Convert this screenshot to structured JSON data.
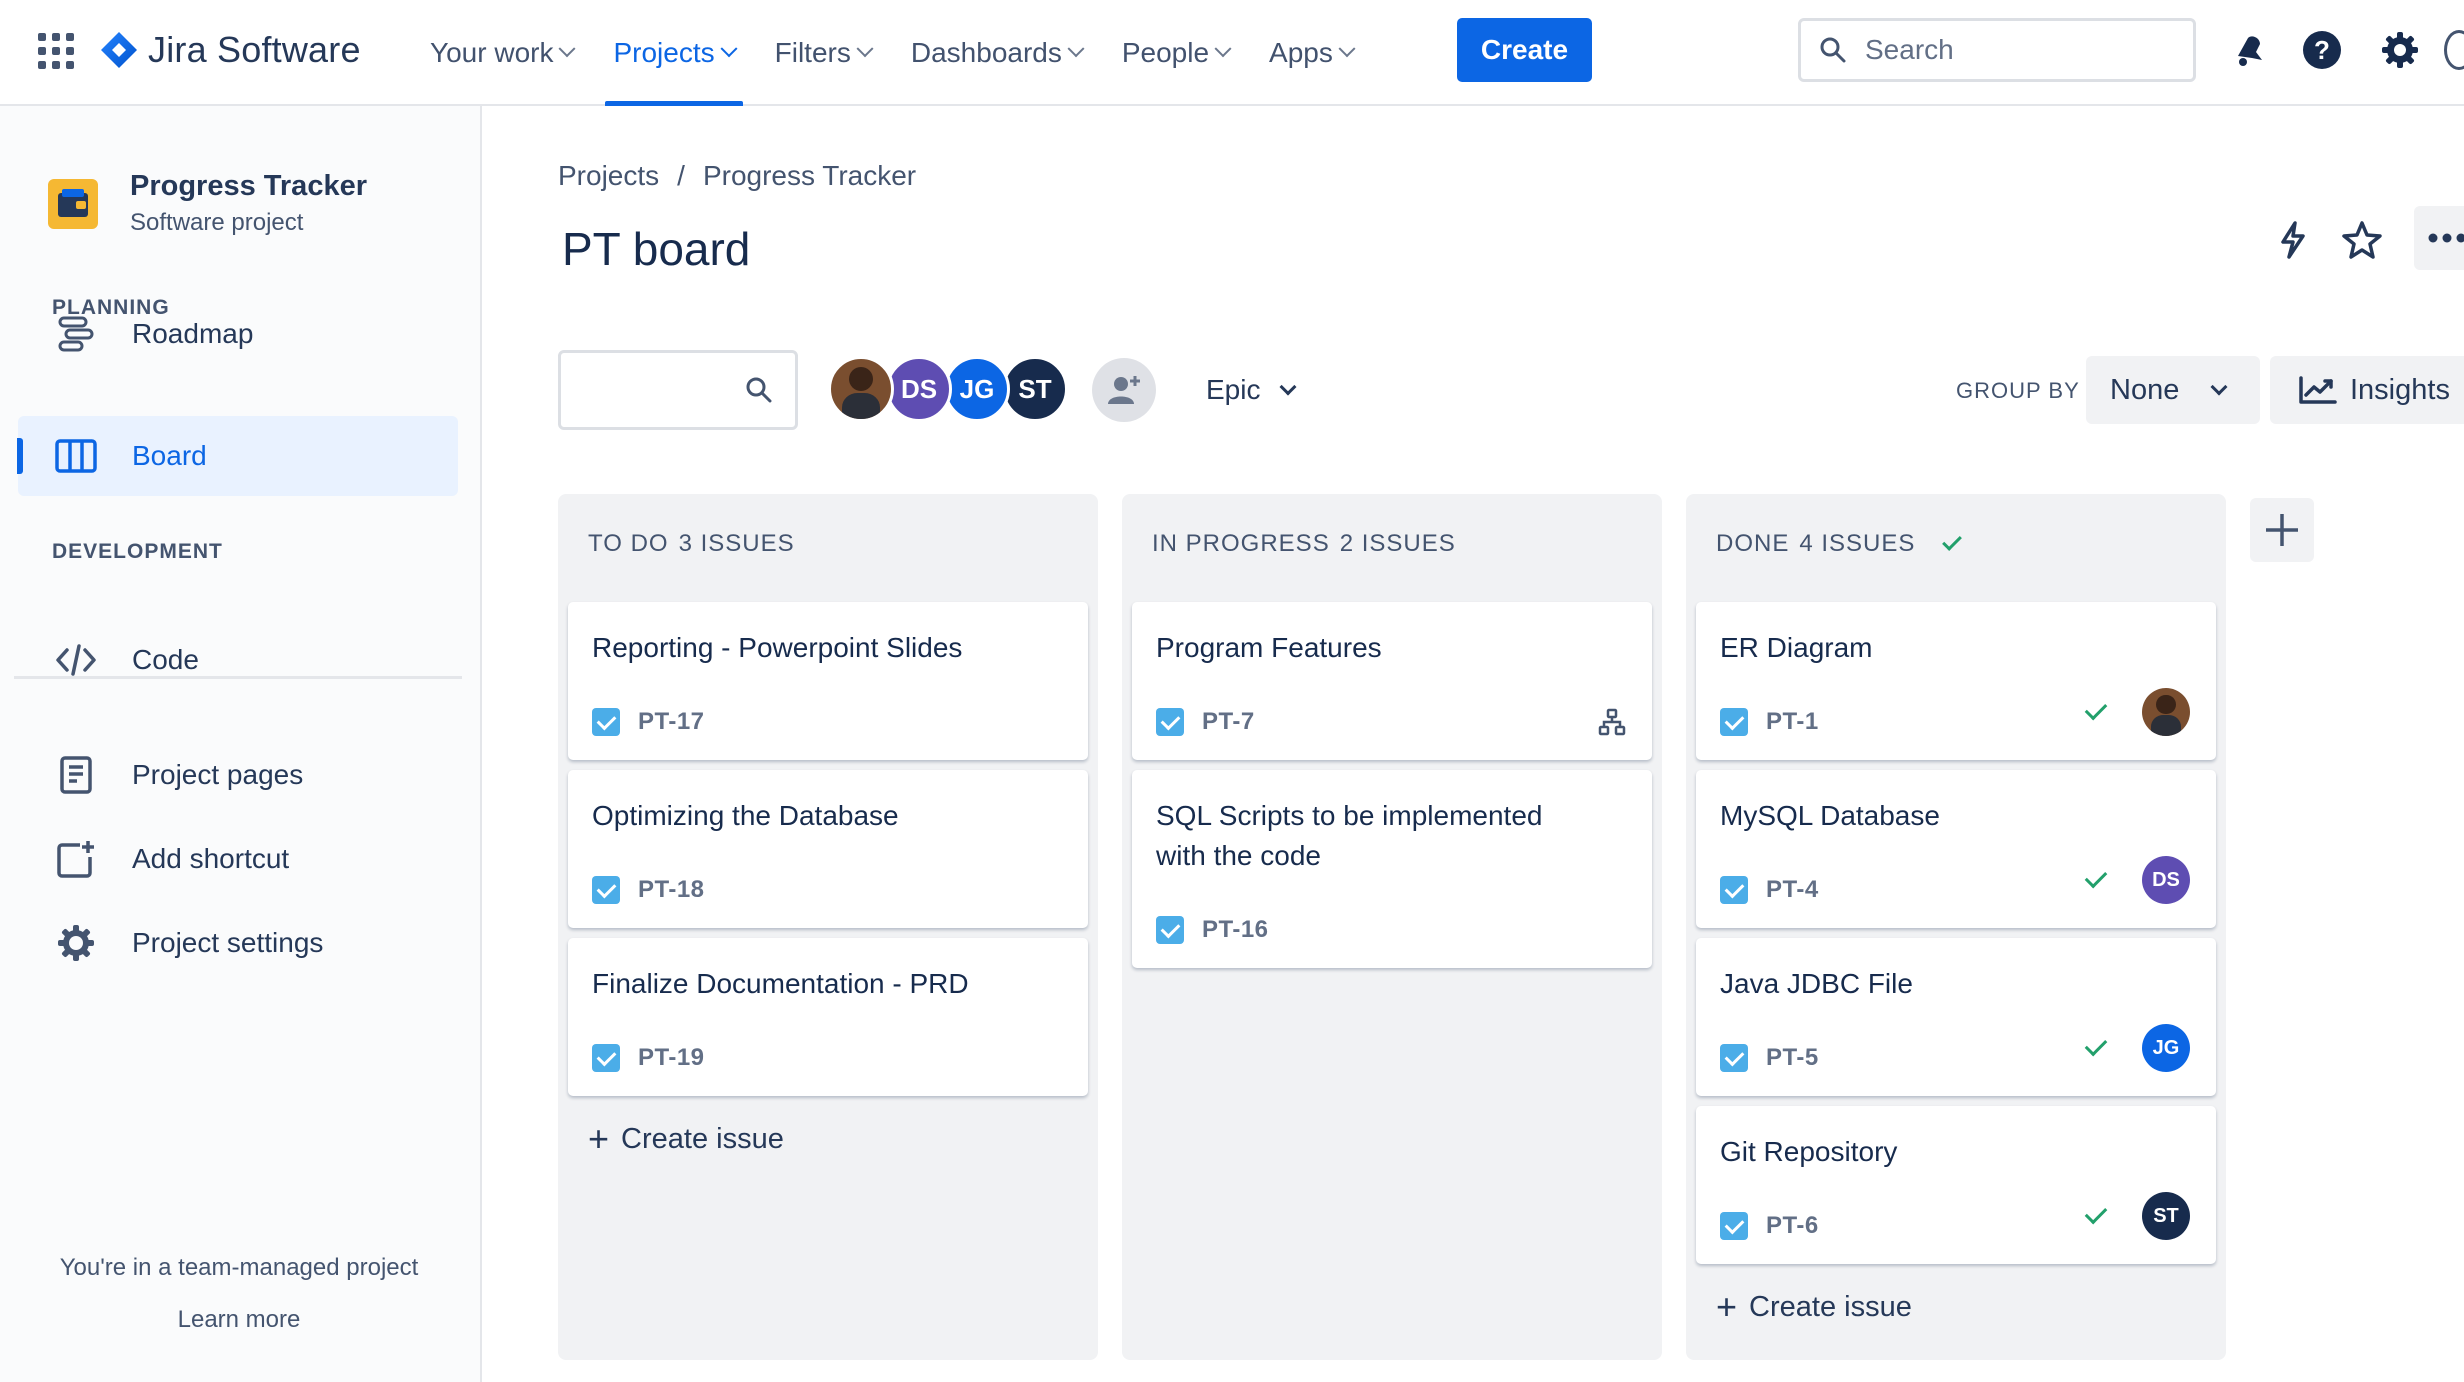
{
  "app": {
    "name": "Jira Software"
  },
  "nav": {
    "items": [
      {
        "label": "Your work",
        "active": false
      },
      {
        "label": "Projects",
        "active": true
      },
      {
        "label": "Filters",
        "active": false
      },
      {
        "label": "Dashboards",
        "active": false
      },
      {
        "label": "People",
        "active": false
      },
      {
        "label": "Apps",
        "active": false
      }
    ],
    "create_label": "Create",
    "search_placeholder": "Search",
    "icons": [
      "notifications-icon",
      "help-icon",
      "settings-icon"
    ]
  },
  "sidebar": {
    "project_name": "Progress Tracker",
    "project_type": "Software project",
    "planning_label": "PLANNING",
    "development_label": "DEVELOPMENT",
    "planning_items": [
      {
        "label": "Roadmap",
        "icon": "roadmap-icon",
        "active": false
      },
      {
        "label": "Board",
        "icon": "board-icon",
        "active": true
      }
    ],
    "development_items": [
      {
        "label": "Code",
        "icon": "code-icon",
        "active": false
      }
    ],
    "extra_items": [
      {
        "label": "Project pages",
        "icon": "page-icon"
      },
      {
        "label": "Add shortcut",
        "icon": "add-shortcut-icon"
      },
      {
        "label": "Project settings",
        "icon": "settings-icon"
      }
    ],
    "footer_text": "You're in a team-managed project",
    "footer_link": "Learn more"
  },
  "main": {
    "breadcrumb": [
      "Projects",
      "Progress Tracker"
    ],
    "title": "PT board",
    "epic_label": "Epic",
    "group_by_label": "GROUP BY",
    "group_by_value": "None",
    "insights_label": "Insights",
    "people": [
      {
        "initials": "",
        "color": "#7a4e2f",
        "photo": true
      },
      {
        "initials": "DS",
        "color": "#5e4db2"
      },
      {
        "initials": "JG",
        "color": "#0c66e4"
      },
      {
        "initials": "ST",
        "color": "#172b4d"
      }
    ]
  },
  "board": {
    "create_issue_label": "Create issue",
    "columns": [
      {
        "name": "TO DO",
        "count": "3 ISSUES",
        "done": false,
        "cards": [
          {
            "title": "Reporting - Powerpoint Slides",
            "key": "PT-17"
          },
          {
            "title": "Optimizing the Database",
            "key": "PT-18"
          },
          {
            "title": "Finalize Documentation - PRD",
            "key": "PT-19"
          }
        ]
      },
      {
        "name": "IN PROGRESS",
        "count": "2 ISSUES",
        "done": false,
        "cards": [
          {
            "title": "Program Features",
            "key": "PT-7",
            "child_icon": true
          },
          {
            "title": "SQL Scripts to be implemented with the code",
            "key": "PT-16"
          }
        ]
      },
      {
        "name": "DONE",
        "count": "4 ISSUES",
        "done": true,
        "cards": [
          {
            "title": "ER Diagram",
            "key": "PT-1",
            "assignee": {
              "initials": "",
              "color": "#7a4e2f",
              "photo": true
            }
          },
          {
            "title": "MySQL Database",
            "key": "PT-4",
            "assignee": {
              "initials": "DS",
              "color": "#5e4db2"
            }
          },
          {
            "title": "Java JDBC File",
            "key": "PT-5",
            "assignee": {
              "initials": "JG",
              "color": "#0c66e4"
            }
          },
          {
            "title": "Git Repository",
            "key": "PT-6",
            "assignee": {
              "initials": "ST",
              "color": "#172b4d"
            }
          }
        ]
      }
    ]
  },
  "colors": {
    "brand": "#0c66e4",
    "done_green": "#22a06b",
    "task_blue": "#4bade8",
    "column_bg": "#f1f2f4"
  }
}
